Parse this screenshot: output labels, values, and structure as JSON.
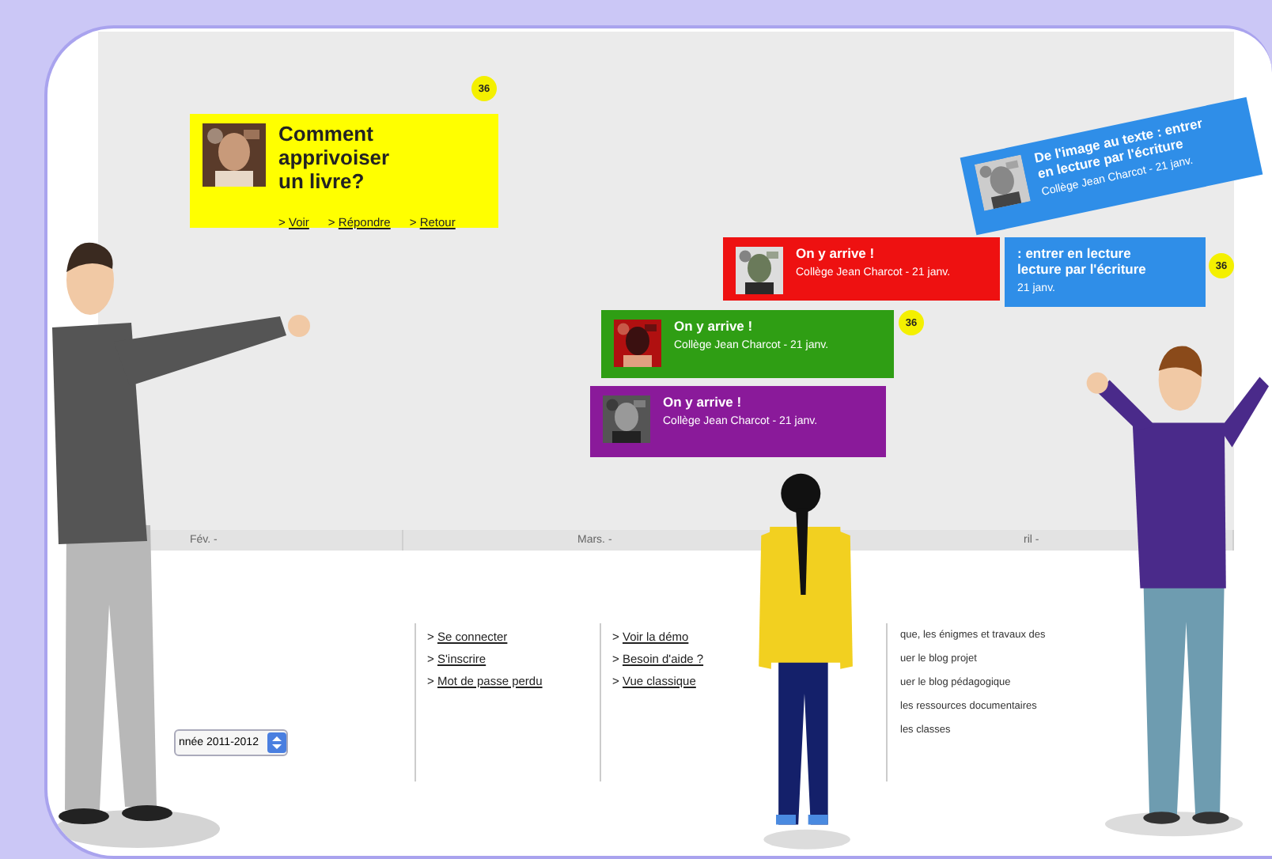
{
  "cards": [
    {
      "color": "#ffff00",
      "title": "Comment apprivoiser\nun livre?",
      "badge": "36",
      "links": [
        {
          "prefix": ">",
          "label": "Voir"
        },
        {
          "prefix": ">",
          "label": "Répondre"
        },
        {
          "prefix": ">",
          "label": "Retour"
        }
      ]
    },
    {
      "color": "#2f8ee8",
      "title": "De l'image au texte : entrer\nen lecture par l'écriture",
      "subtitle": "Collège Jean Charcot - 21 janv."
    },
    {
      "color": "#ee1111",
      "title": "On y arrive !",
      "subtitle": "Collège Jean Charcot - 21 janv."
    },
    {
      "color": "#2f8ee8",
      "title": ": entrer en lecture\nlecture par l'écriture",
      "subtitle": "21 janv.",
      "badge": "36"
    },
    {
      "color": "#2f9e14",
      "title": "On y arrive !",
      "subtitle": "Collège Jean Charcot - 21 janv.",
      "badge": "36"
    },
    {
      "color": "#8a1a9a",
      "title": "On y arrive !",
      "subtitle": "Collège Jean Charcot - 21 janv."
    }
  ],
  "months": [
    "Fév. -",
    "Mars. -",
    "ril -"
  ],
  "year_select": {
    "value": "nnée 2011-2012"
  },
  "link_columns": [
    {
      "links": [
        {
          "prefix": ">",
          "label": "Se connecter"
        },
        {
          "prefix": ">",
          "label": "S'inscrire"
        },
        {
          "prefix": ">",
          "label": "Mot de passe perdu"
        }
      ]
    },
    {
      "links": [
        {
          "prefix": ">",
          "label": "Voir la démo"
        },
        {
          "prefix": ">",
          "label": "Besoin d'aide ?"
        },
        {
          "prefix": ">",
          "label": "Vue classique"
        }
      ]
    }
  ],
  "menu_items": [
    "que, les énigmes et travaux des",
    "uer le blog projet",
    "uer le blog pédagogique",
    "les ressources documentaires",
    "les classes"
  ]
}
